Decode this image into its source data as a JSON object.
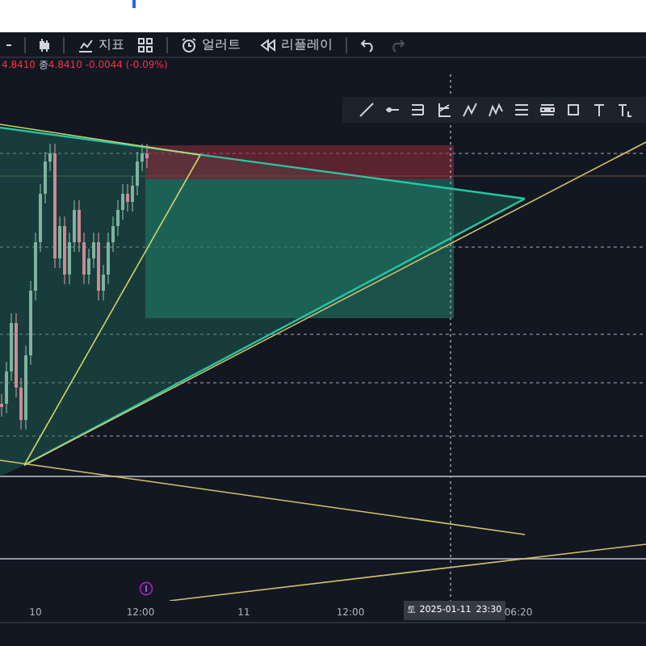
{
  "toolbar": {
    "indicators_label": "지표",
    "alert_label": "얼러트",
    "replay_label": "리플레이",
    "redo_disabled": true
  },
  "legend": {
    "open": "4.8410",
    "close_label": "종",
    "close": "4.8410",
    "change": "-0.0044 (-0.09%)"
  },
  "time_axis": {
    "labels": [
      "10",
      "12:00",
      "11",
      "12:00"
    ],
    "crosshair": {
      "date": "토 2025-01-11",
      "time": "23:30"
    },
    "last_label": "06:20"
  }
}
